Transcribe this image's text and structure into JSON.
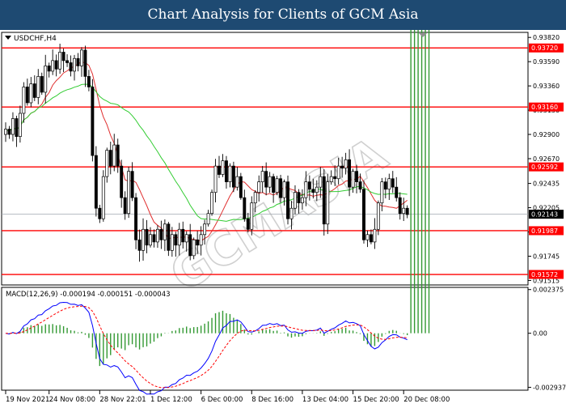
{
  "header": {
    "title": "Chart Analysis for Clients of GCM Asia"
  },
  "watermark": "GCMASIA",
  "chart_data": {
    "type": "candlestick",
    "symbol_label": "USDCHF,H4",
    "price_axis": {
      "ylim": [
        0.9148,
        0.9386
      ],
      "tick_labels": [
        "0.93820",
        "0.93590",
        "0.93360",
        "0.93130",
        "0.92900",
        "0.92670",
        "0.92435",
        "0.92205",
        "0.91975",
        "0.91745",
        "0.91515"
      ],
      "tick_values": [
        0.9382,
        0.9359,
        0.9336,
        0.9313,
        0.929,
        0.9267,
        0.92435,
        0.92205,
        0.91975,
        0.91745,
        0.91515
      ]
    },
    "current_price": {
      "label": "0.92143",
      "value": 0.92143
    },
    "levels": [
      {
        "label": "0.93720",
        "value": 0.9372
      },
      {
        "label": "0.93160",
        "value": 0.9316
      },
      {
        "label": "0.92592",
        "value": 0.92592
      },
      {
        "label": "0.91987",
        "value": 0.91987
      },
      {
        "label": "0.91572",
        "value": 0.91572
      }
    ],
    "x_labels": [
      "19 Nov 2021",
      "24 Nov 08:00",
      "28 Nov 22:01",
      "1 Dec 12:00",
      "6 Dec 00:00",
      "8 Dec 16:00",
      "13 Dec 04:00",
      "15 Dec 20:00",
      "20 Dec 08:00"
    ],
    "x_label_index": [
      0,
      12,
      26,
      40,
      54,
      68,
      82,
      96,
      110
    ],
    "candle_count": 118,
    "closes": [
      0.9295,
      0.929,
      0.9305,
      0.9288,
      0.931,
      0.9335,
      0.932,
      0.9338,
      0.9325,
      0.9345,
      0.933,
      0.9355,
      0.935,
      0.936,
      0.9352,
      0.9368,
      0.936,
      0.9358,
      0.935,
      0.9362,
      0.9355,
      0.937,
      0.9345,
      0.9335,
      0.927,
      0.922,
      0.921,
      0.925,
      0.9275,
      0.926,
      0.928,
      0.926,
      0.923,
      0.9215,
      0.9255,
      0.923,
      0.919,
      0.918,
      0.92,
      0.9185,
      0.9195,
      0.9188,
      0.92,
      0.919,
      0.9205,
      0.918,
      0.9195,
      0.9185,
      0.92,
      0.9188,
      0.9195,
      0.9175,
      0.919,
      0.9185,
      0.9195,
      0.9205,
      0.9215,
      0.9235,
      0.926,
      0.9252,
      0.9265,
      0.9245,
      0.926,
      0.924,
      0.925,
      0.923,
      0.921,
      0.92,
      0.9225,
      0.9235,
      0.9245,
      0.9255,
      0.924,
      0.925,
      0.9235,
      0.9248,
      0.923,
      0.9245,
      0.921,
      0.922,
      0.9235,
      0.9225,
      0.923,
      0.9245,
      0.9238,
      0.9235,
      0.924,
      0.925,
      0.9205,
      0.9245,
      0.925,
      0.9248,
      0.926,
      0.9258,
      0.9266,
      0.924,
      0.9255,
      0.9245,
      0.9238,
      0.919,
      0.9195,
      0.9188,
      0.92,
      0.9225,
      0.9245,
      0.9238,
      0.9248,
      0.924,
      0.923,
      0.9215,
      0.922,
      0.9214
    ],
    "moving_averages": [
      {
        "color": "#e03030",
        "period": 10
      },
      {
        "color": "#33cc33",
        "period": 30
      }
    ],
    "macd": {
      "label": "MACD(12,26,9) -0.000194 -0.000151 -0.000043",
      "params": [
        12,
        26,
        9
      ],
      "values": [
        -0.000194,
        -0.000151,
        -4.3e-05
      ],
      "ylim": [
        -0.00305,
        0.00245
      ],
      "tick_labels": [
        "0.002375",
        "0.00",
        "-0.002937"
      ],
      "tick_values": [
        0.002375,
        0.0,
        -0.002937
      ],
      "main_color": "#0000ff",
      "signal_color": "#ff0000",
      "histogram_color": "#339933"
    },
    "colors": {
      "up": "#ffffff",
      "down": "#000000",
      "levels": "#ff0000",
      "current_line": "#a0a8b0"
    }
  }
}
